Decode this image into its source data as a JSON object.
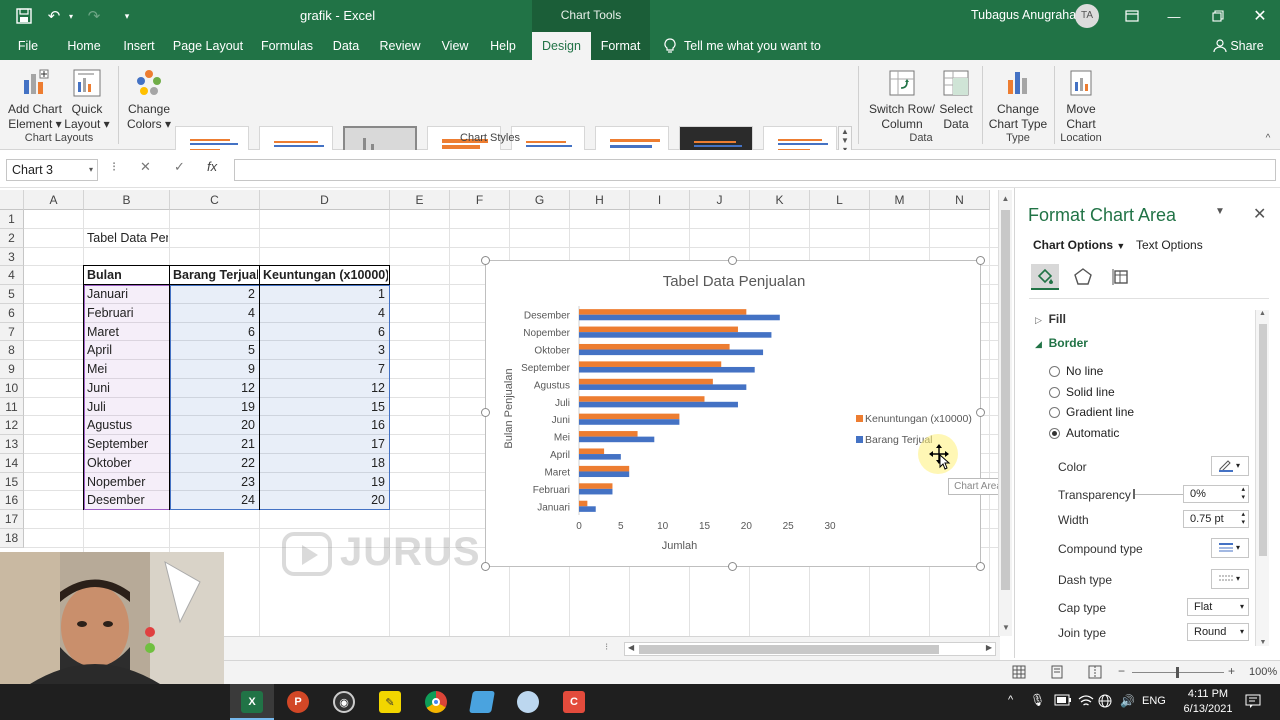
{
  "window": {
    "title": "grafik  -  Excel",
    "context_tab": "Chart Tools",
    "user_name": "Tubagus Anugraha",
    "user_initials": "TA"
  },
  "tabs": [
    {
      "label": "File"
    },
    {
      "label": "Home"
    },
    {
      "label": "Insert"
    },
    {
      "label": "Page Layout"
    },
    {
      "label": "Formulas"
    },
    {
      "label": "Data"
    },
    {
      "label": "Review"
    },
    {
      "label": "View"
    },
    {
      "label": "Help"
    },
    {
      "label": "Design"
    },
    {
      "label": "Format"
    }
  ],
  "tell_me": "Tell me what you want to do",
  "share": "Share",
  "ribbon": {
    "add_chart_element": [
      "Add Chart",
      "Element"
    ],
    "quick_layout": [
      "Quick",
      "Layout"
    ],
    "change_colors": [
      "Change",
      "Colors"
    ],
    "switch_row_col": [
      "Switch Row/",
      "Column"
    ],
    "select_data": [
      "Select",
      "Data"
    ],
    "change_chart_type": [
      "Change",
      "Chart Type"
    ],
    "move_chart": [
      "Move",
      "Chart"
    ],
    "groups": {
      "chart_layouts": "Chart Layouts",
      "chart_styles": "Chart Styles",
      "data": "Data",
      "type": "Type",
      "location": "Location"
    }
  },
  "formula_bar": {
    "name_box": "Chart 3",
    "fx": "fx",
    "formula": ""
  },
  "columns": [
    "A",
    "B",
    "C",
    "D",
    "E",
    "F",
    "G",
    "H",
    "I",
    "J",
    "K",
    "L",
    "M",
    "N"
  ],
  "rows": [
    "1",
    "2",
    "3",
    "4",
    "5",
    "6",
    "7",
    "8",
    "9",
    "10",
    "11",
    "12",
    "13",
    "14",
    "15",
    "16",
    "17",
    "18"
  ],
  "table": {
    "title": "Tabel Data Penjualan",
    "headers": [
      "Bulan",
      "Barang Terjual",
      "Keuntungan (x10000)"
    ],
    "rows": [
      [
        "Januari",
        "2",
        "1"
      ],
      [
        "Februari",
        "4",
        "4"
      ],
      [
        "Maret",
        "6",
        "6"
      ],
      [
        "April",
        "5",
        "3"
      ],
      [
        "Mei",
        "9",
        "7"
      ],
      [
        "Juni",
        "12",
        "12"
      ],
      [
        "Juli",
        "19",
        "15"
      ],
      [
        "Agustus",
        "20",
        "16"
      ],
      [
        "September",
        "21",
        "17"
      ],
      [
        "Oktober",
        "22",
        "18"
      ],
      [
        "Nopember",
        "23",
        "19"
      ],
      [
        "Desember",
        "24",
        "20"
      ]
    ]
  },
  "chart_data": {
    "type": "bar",
    "orientation": "horizontal",
    "title": "Tabel Data Penjualan",
    "xlabel": "Jumlah",
    "ylabel": "Bulan Penjualan",
    "categories": [
      "Januari",
      "Februari",
      "Maret",
      "April",
      "Mei",
      "Juni",
      "Juli",
      "Agustus",
      "September",
      "Oktober",
      "Nopember",
      "Desember"
    ],
    "series": [
      {
        "name": "Barang Terjual",
        "color": "#4472c4",
        "values": [
          2,
          4,
          6,
          5,
          9,
          12,
          19,
          20,
          21,
          22,
          23,
          24
        ]
      },
      {
        "name": "Kenuntungan (x10000)",
        "color": "#ed7d31",
        "values": [
          1,
          4,
          6,
          3,
          7,
          12,
          15,
          16,
          17,
          18,
          19,
          20
        ]
      }
    ],
    "xlim": [
      0,
      30
    ],
    "xticks": [
      0,
      5,
      10,
      15,
      20,
      25,
      30
    ],
    "grid": false,
    "legend_position": "right"
  },
  "tooltip": "Chart Area",
  "watermark": "JURUS DIGITAL",
  "pane": {
    "title": "Format Chart Area",
    "tab_chart_options": "Chart Options",
    "tab_text_options": "Text Options",
    "fill_label": "Fill",
    "border_label": "Border",
    "radios": [
      "No line",
      "Solid line",
      "Gradient line",
      "Automatic"
    ],
    "selected_radio": "Automatic",
    "props": {
      "color": "Color",
      "transparency": "Transparency",
      "transparency_value": "0%",
      "width": "Width",
      "width_value": "0.75 pt",
      "compound": "Compound type",
      "dash": "Dash type",
      "cap": "Cap type",
      "cap_value": "Flat",
      "join": "Join type",
      "join_value": "Round"
    }
  },
  "status": {
    "zoom": "100%"
  },
  "taskbar": {
    "lang": "ENG",
    "time": "4:11 PM",
    "date": "6/13/2021"
  },
  "colors": {
    "excel_green": "#217346",
    "series_blue": "#4472c4",
    "series_orange": "#ed7d31"
  }
}
